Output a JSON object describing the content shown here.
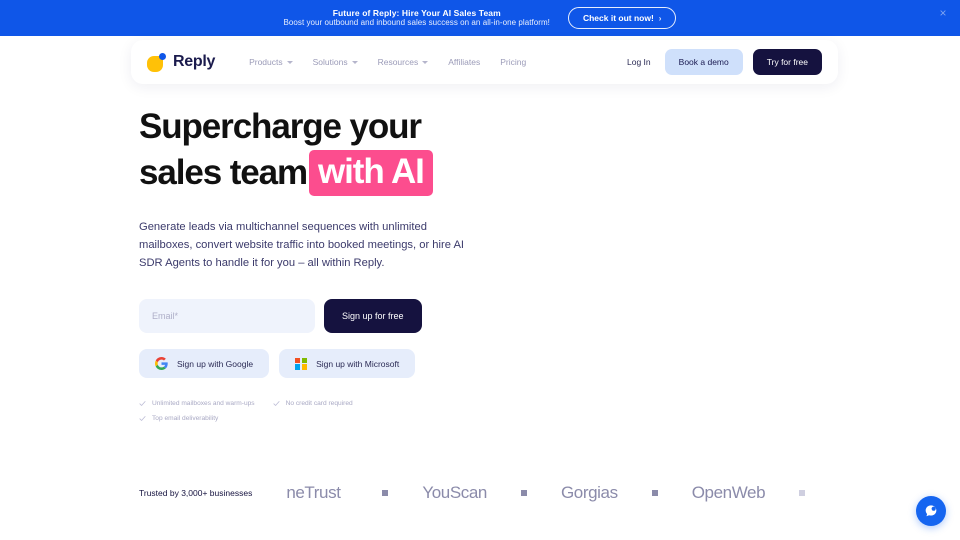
{
  "promo_banner": {
    "title": "Future of Reply: Hire Your AI Sales Team",
    "subtitle": "Boost your outbound and inbound sales success on an all-in-one platform!",
    "cta_label": "Check it out now!",
    "cta_chevron": "›",
    "close_icon": "×",
    "background_color": "#0F56E8"
  },
  "nav": {
    "logo_text": "Reply",
    "logo_icon": "reply-logo-icon",
    "links": [
      {
        "label": "Products",
        "has_dropdown": true
      },
      {
        "label": "Solutions",
        "has_dropdown": true
      },
      {
        "label": "Resources",
        "has_dropdown": true
      },
      {
        "label": "Affiliates",
        "has_dropdown": false
      },
      {
        "label": "Pricing",
        "has_dropdown": false
      }
    ],
    "login_label": "Log In",
    "demo_label": "Book a demo",
    "try_label": "Try for free",
    "demo_color": "#CFE0FB",
    "try_color": "#15123F"
  },
  "hero": {
    "headline_line1": "Supercharge your",
    "headline_line2_plain": "sales team",
    "headline_line2_highlight": "with AI",
    "highlight_color": "#FC4D8E",
    "subcopy": "Generate leads via multichannel sequences with unlimited mailboxes, convert website traffic into booked meetings, or hire AI SDR Agents to handle it for you – all within Reply."
  },
  "signup": {
    "email_placeholder": "Email*",
    "email_value": "",
    "submit_label": "Sign up for free",
    "google_label": "Sign up with Google",
    "google_icon": "google-icon",
    "microsoft_label": "Sign up with Microsoft",
    "microsoft_icon": "microsoft-icon"
  },
  "features": [
    "Unlimited mailboxes and warm-ups",
    "No credit card required",
    "Top email deliverability"
  ],
  "trusted": {
    "label": "Trusted by 3,000+ businesses",
    "brands": [
      "neTrust",
      "YouScan",
      "Gorgias",
      "OpenWeb"
    ]
  },
  "chat": {
    "icon": "chat-bubble-icon",
    "color": "#1565F0"
  }
}
